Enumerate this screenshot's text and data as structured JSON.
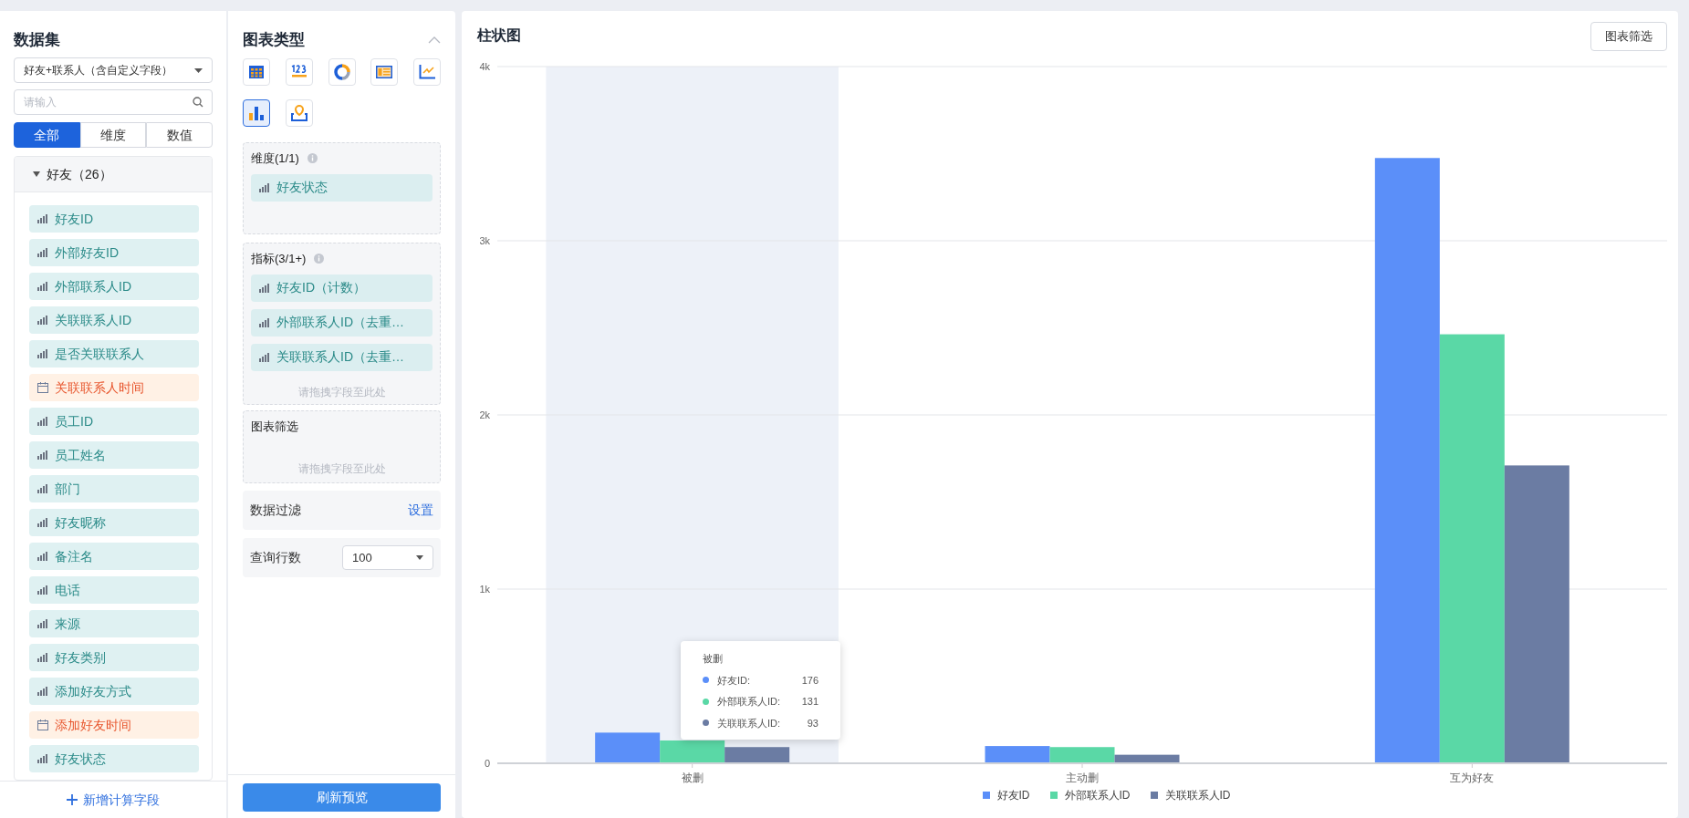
{
  "dataset_panel": {
    "title": "数据集",
    "dataset_select": "好友+联系人（含自定义字段）",
    "search": {
      "placeholder": "请输入"
    },
    "tabs": [
      {
        "label": "全部",
        "selected": true
      },
      {
        "label": "维度",
        "selected": false
      },
      {
        "label": "数值",
        "selected": false
      }
    ],
    "group": {
      "label": "好友（26）",
      "expanded": true,
      "fields": [
        {
          "label": "好友ID",
          "kind": "field"
        },
        {
          "label": "外部好友ID",
          "kind": "field"
        },
        {
          "label": "外部联系人ID",
          "kind": "field"
        },
        {
          "label": "关联联系人ID",
          "kind": "field"
        },
        {
          "label": "是否关联联系人",
          "kind": "field"
        },
        {
          "label": "关联联系人时间",
          "kind": "date"
        },
        {
          "label": "员工ID",
          "kind": "field"
        },
        {
          "label": "员工姓名",
          "kind": "field"
        },
        {
          "label": "部门",
          "kind": "field"
        },
        {
          "label": "好友昵称",
          "kind": "field"
        },
        {
          "label": "备注名",
          "kind": "field"
        },
        {
          "label": "电话",
          "kind": "field"
        },
        {
          "label": "来源",
          "kind": "field"
        },
        {
          "label": "好友类别",
          "kind": "field"
        },
        {
          "label": "添加好友方式",
          "kind": "field"
        },
        {
          "label": "添加好友时间",
          "kind": "date"
        },
        {
          "label": "好友状态",
          "kind": "field"
        }
      ]
    },
    "add_button": "新增计算字段"
  },
  "config_panel": {
    "title": "图表类型",
    "chart_types": [
      {
        "kind": "table",
        "selected": false
      },
      {
        "kind": "number",
        "selected": false
      },
      {
        "kind": "donut",
        "selected": false
      },
      {
        "kind": "list",
        "selected": false
      },
      {
        "kind": "line",
        "selected": false
      },
      {
        "kind": "bar",
        "selected": true
      },
      {
        "kind": "map",
        "selected": false
      }
    ],
    "dimension": {
      "label": "维度(1/1)",
      "fields": [
        "好友状态"
      ]
    },
    "measures": {
      "label": "指标(3/1+)",
      "fields": [
        "好友ID（计数）",
        "外部联系人ID（去重…",
        "关联联系人ID（去重…"
      ],
      "hint": "请拖拽字段至此处"
    },
    "chart_filter": {
      "label": "图表筛选",
      "hint": "请拖拽字段至此处"
    },
    "data_filter": {
      "label": "数据过滤",
      "action": "设置"
    },
    "row_limit": {
      "label": "查询行数",
      "value": "100"
    },
    "refresh_button": "刷新预览"
  },
  "chart_panel": {
    "title": "柱状图",
    "filter_button": "图表筛选",
    "chart_data": {
      "type": "bar",
      "categories": [
        "被删",
        "主动删",
        "互为好友"
      ],
      "series": [
        {
          "name": "好友ID",
          "color": "#5b8ff9",
          "values": [
            176,
            99,
            3475
          ]
        },
        {
          "name": "外部联系人ID",
          "color": "#5ad8a6",
          "values": [
            131,
            93,
            2463
          ]
        },
        {
          "name": "关联联系人ID",
          "color": "#6b7ca3",
          "values": [
            93,
            49,
            1710
          ]
        }
      ],
      "ylim": [
        0,
        4000
      ],
      "grid": true,
      "bands": [
        {
          "axis": "x",
          "from": "被删",
          "to": "被删",
          "color": "#edf1f8"
        }
      ],
      "yticks": [
        {
          "value": 0,
          "label": "0"
        },
        {
          "value": 1000,
          "label": "1k"
        },
        {
          "value": 2000,
          "label": "2k"
        },
        {
          "value": 3000,
          "label": "3k"
        },
        {
          "value": 4000,
          "label": "4k"
        }
      ]
    },
    "tooltip": {
      "title": "被删",
      "rows": [
        {
          "label": "好友ID:",
          "value": "176",
          "color": "#5b8ff9"
        },
        {
          "label": "外部联系人ID:",
          "value": "131",
          "color": "#5ad8a6"
        },
        {
          "label": "关联联系人ID:",
          "value": "93",
          "color": "#6b7ca3"
        }
      ]
    }
  }
}
